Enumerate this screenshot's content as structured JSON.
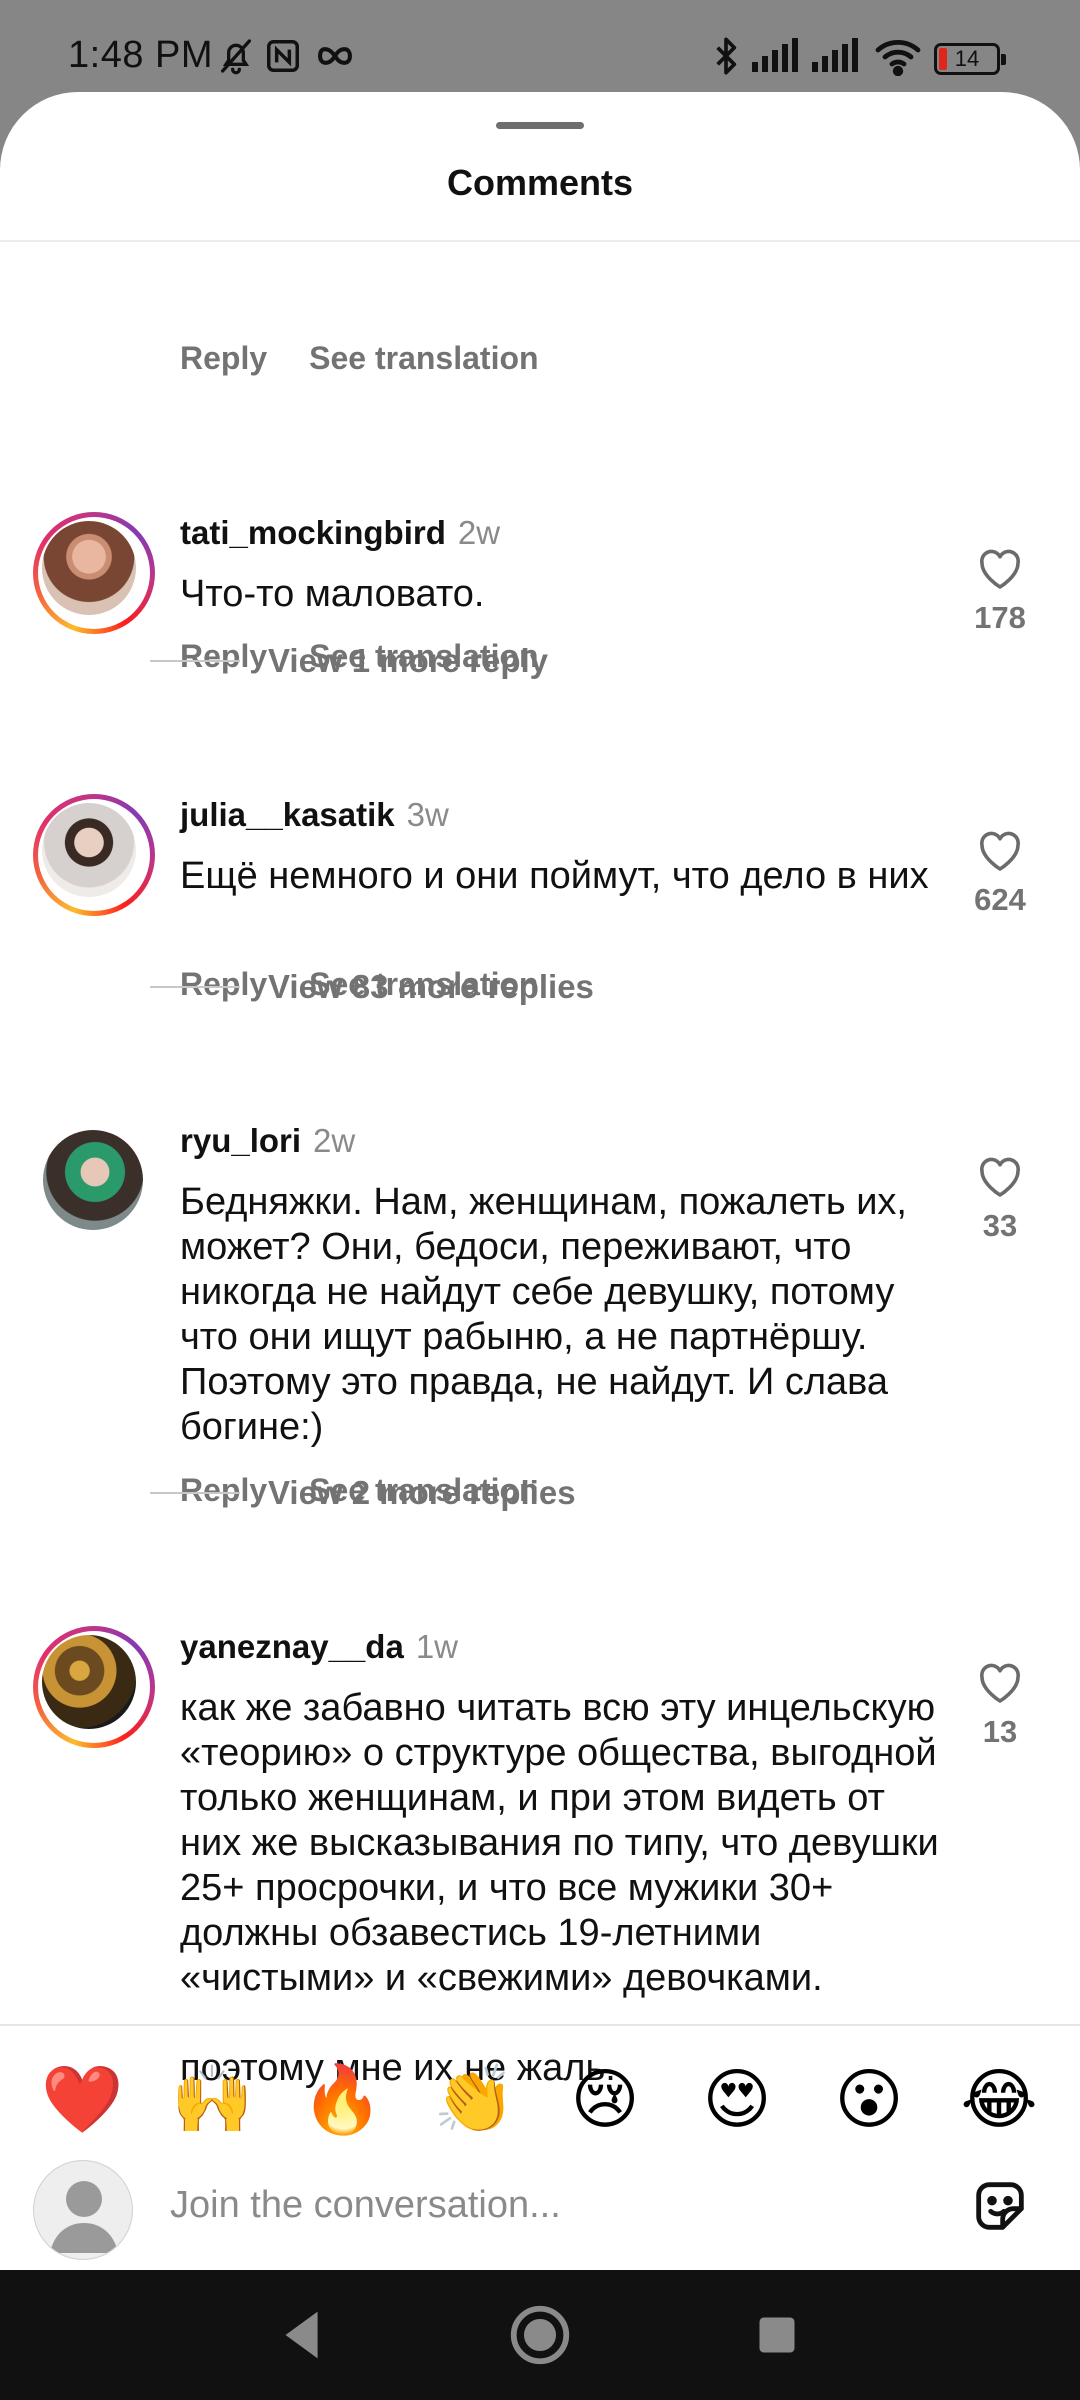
{
  "status_bar": {
    "time": "1:48 PM",
    "battery_level": "14",
    "battery_fraction": 0.14,
    "icons": [
      "mute-icon",
      "nfc-icon",
      "infinity-icon",
      "bluetooth-icon",
      "signal-icon",
      "signal-icon",
      "wifi-icon",
      "battery-icon"
    ]
  },
  "sheet": {
    "title": "Comments"
  },
  "actions": {
    "reply": "Reply",
    "see_translation": "See translation"
  },
  "comments": [
    {
      "username": "tati_mockingbird",
      "time": "2w",
      "text": "Что-то маловато.",
      "likes": "178",
      "story_ring": true,
      "view_more": "View 1 more reply"
    },
    {
      "username": "julia__kasatik",
      "time": "3w",
      "text": "Ещё немного и они поймут, что дело в них",
      "likes": "624",
      "story_ring": true,
      "view_more": "View 83 more replies"
    },
    {
      "username": "ryu_lori",
      "time": "2w",
      "text": "Бедняжки. Нам, женщинам, пожалеть их, может? Они, бедоси, переживают, что никогда не найдут себе девушку, потому что они ищут рабыню, а не партнёршу. Поэтому это правда, не найдут. И слава богине:)",
      "likes": "33",
      "story_ring": false,
      "view_more": "View 2 more replies"
    },
    {
      "username": "yaneznay__da",
      "time": "1w",
      "text": "как же забавно читать всю эту инцельскую «теорию» о структуре общества, выгодной только женщинам, и при этом видеть от них же высказывания по типу, что девушки 25+ просрочки, и что все мужики 30+ должны обзавестись 19-летними «чистыми» и «свежими» девочками.\n\nпоэтому мне их не жаль.",
      "likes": "13",
      "story_ring": true
    }
  ],
  "emoji_bar": [
    "❤️",
    "🙌",
    "🔥",
    "👏",
    "😢",
    "😍",
    "😮",
    "😂"
  ],
  "input": {
    "placeholder": "Join the conversation..."
  },
  "colors": {
    "story_ring": "#e1306c",
    "secondary_text": "#737373",
    "sheet_bg": "#ffffff",
    "nav_bg": "#111111"
  }
}
